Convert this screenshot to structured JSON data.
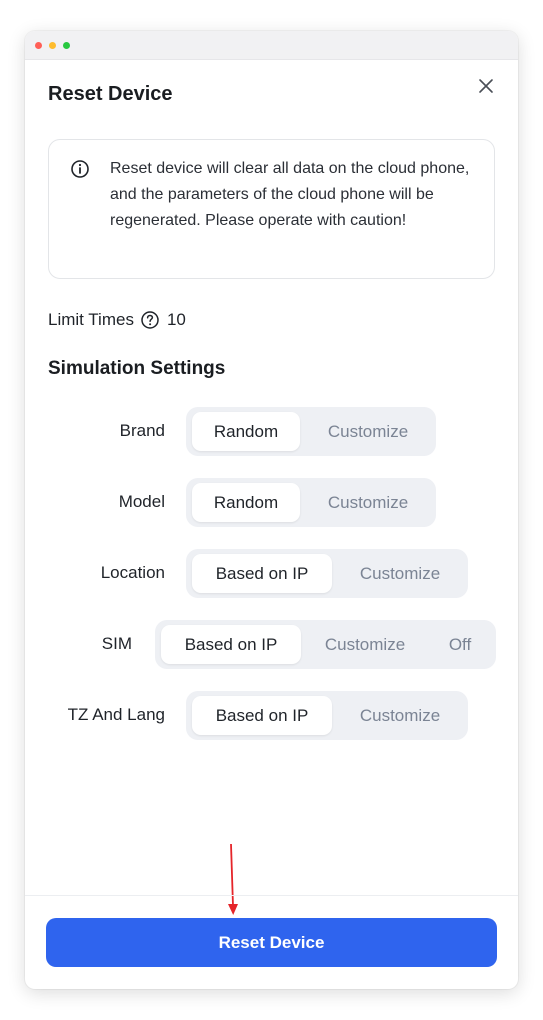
{
  "window": {
    "controls": [
      "close",
      "minimize",
      "zoom"
    ],
    "colors": {
      "close": "#ff5f57",
      "minimize": "#febc2e",
      "zoom": "#28c840"
    }
  },
  "modal": {
    "title": "Reset Device",
    "close_icon": "close-icon"
  },
  "warning": {
    "icon": "info-icon",
    "text": "Reset device will clear all data on the cloud phone, and the parameters of the cloud phone will be regenerated. Please operate with caution!"
  },
  "limit": {
    "label": "Limit Times",
    "icon": "help-icon",
    "value": "10"
  },
  "simulation": {
    "title": "Simulation Settings",
    "settings": [
      {
        "label": "Brand",
        "options": [
          "Random",
          "Customize"
        ],
        "selected": "Random"
      },
      {
        "label": "Model",
        "options": [
          "Random",
          "Customize"
        ],
        "selected": "Random"
      },
      {
        "label": "Location",
        "options": [
          "Based on IP",
          "Customize"
        ],
        "selected": "Based on IP"
      },
      {
        "label": "SIM",
        "options": [
          "Based on IP",
          "Customize",
          "Off"
        ],
        "selected": "Based on IP"
      },
      {
        "label": "TZ And Lang",
        "options": [
          "Based on IP",
          "Customize"
        ],
        "selected": "Based on IP"
      }
    ]
  },
  "footer": {
    "reset_label": "Reset Device",
    "accent": "#2f64ee"
  },
  "annotation": {
    "arrow_color": "#e5252a",
    "points_to": "reset-device-button"
  }
}
